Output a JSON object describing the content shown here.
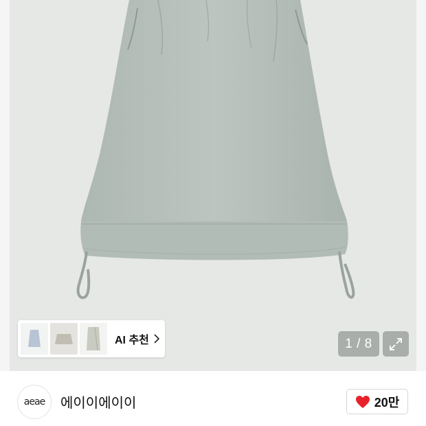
{
  "product": {
    "image_description_icon": "skirt-product-photo",
    "counter_text": "1 / 8"
  },
  "ai_recommend": {
    "label": "AI 추천",
    "thumbnails": [
      "skirt-thumb",
      "mini-skirt-thumb",
      "wrap-skirt-thumb"
    ]
  },
  "brand": {
    "logo_text": "aeae",
    "name": "에이이에이이"
  },
  "like": {
    "icon": "heart-icon",
    "count": "20만",
    "color": "#e8222b"
  },
  "colors": {
    "skirt": "#b7c0bb",
    "background": "#e6e8e6"
  }
}
